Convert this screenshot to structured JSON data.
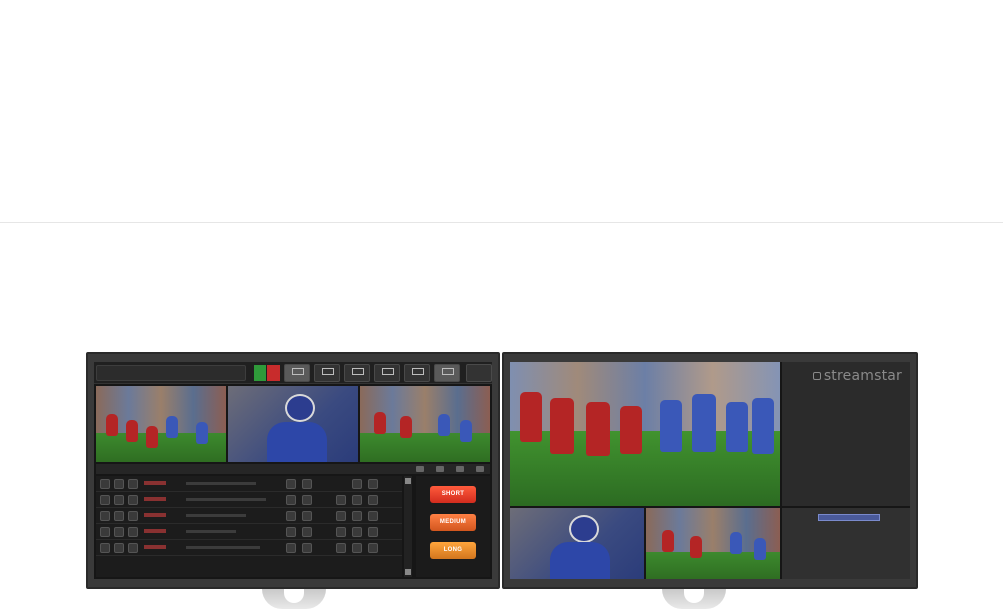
{
  "brand": {
    "name": "streamstar"
  },
  "cut_buttons": {
    "short": "SHORT",
    "medium": "MEDIUM",
    "long": "LONG"
  },
  "icons": [
    "record-indicator",
    "camera-switch-icon",
    "layout-icon",
    "preview-icon",
    "lock-icon"
  ],
  "colors": {
    "short": "#e0392a",
    "medium": "#e0652a",
    "long": "#e6882a",
    "record_green": "#2f9a3a",
    "record_red": "#c82c2c"
  }
}
